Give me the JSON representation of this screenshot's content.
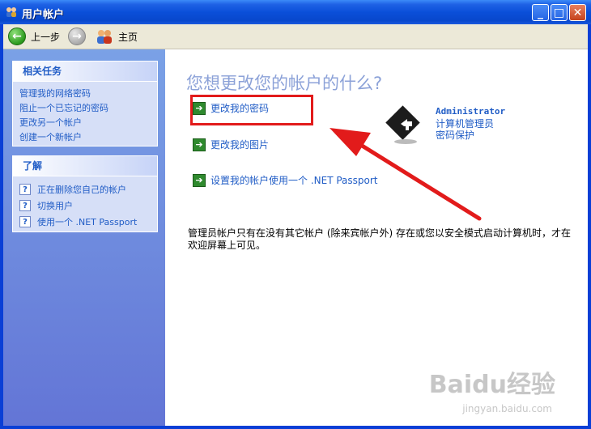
{
  "window": {
    "title": "用户帐户",
    "buttons": {
      "minimize": "_",
      "maximize": "□",
      "close": "✕"
    }
  },
  "toolbar": {
    "back_label": "上一步",
    "home_label": "主页"
  },
  "sidebar": {
    "tasks_title": "相关任务",
    "tasks": [
      {
        "label": "管理我的网络密码"
      },
      {
        "label": "阻止一个已忘记的密码"
      },
      {
        "label": "更改另一个帐户"
      },
      {
        "label": "创建一个新帐户"
      }
    ],
    "learn_title": "了解",
    "learn": [
      {
        "label": "正在删除您自己的帐户"
      },
      {
        "label": "切换用户"
      },
      {
        "label": "使用一个 .NET Passport"
      }
    ]
  },
  "main": {
    "heading": "您想更改您的帐户的什么?",
    "options": [
      {
        "label": "更改我的密码"
      },
      {
        "label": "更改我的图片"
      },
      {
        "label": "设置我的帐户使用一个 .NET Passport"
      }
    ],
    "account": {
      "name": "Administrator",
      "role": "计算机管理员",
      "status": "密码保护"
    },
    "note": "管理员帐户只有在没有其它帐户 (除来宾帐户外) 存在或您以安全模式启动计算机时，才在欢迎屏幕上可见。"
  },
  "watermark": {
    "brand": "Baidu经验",
    "url": "jingyan.baidu.com"
  },
  "colors": {
    "link": "#215dc6",
    "highlight": "#e21b1b",
    "titlebar": "#0a4fd9"
  }
}
